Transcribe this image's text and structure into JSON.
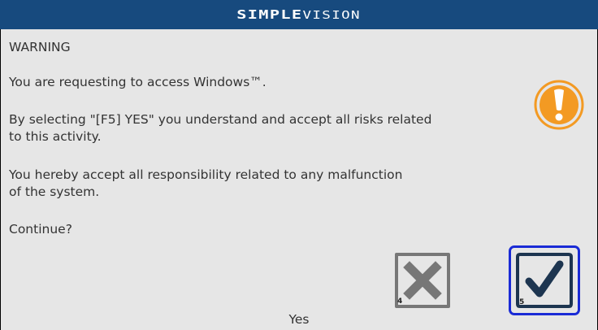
{
  "header": {
    "brand_upper": "SIMPLE",
    "brand_lower": "VISION"
  },
  "dialog": {
    "heading": "WARNING",
    "line_access": "You are requesting to access Windows™.",
    "line_risk_1": "By selecting \"[F5] YES\" you understand and accept all risks related",
    "line_risk_2": "to this activity.",
    "line_resp_1": "You hereby accept all responsibility related to any malfunction",
    "line_resp_2": "of the system.",
    "question": "Continue?",
    "icon": "exclamation-circle-icon"
  },
  "buttons": {
    "no": {
      "key": "4",
      "icon": "x-mark-icon"
    },
    "yes": {
      "key": "5",
      "icon": "checkmark-icon"
    }
  },
  "status_text": "Yes",
  "colors": {
    "titlebar": "#174a7e",
    "warning": "#f39a23",
    "selection": "#1a2bd6",
    "check": "#1d3550",
    "cross": "#777777"
  }
}
